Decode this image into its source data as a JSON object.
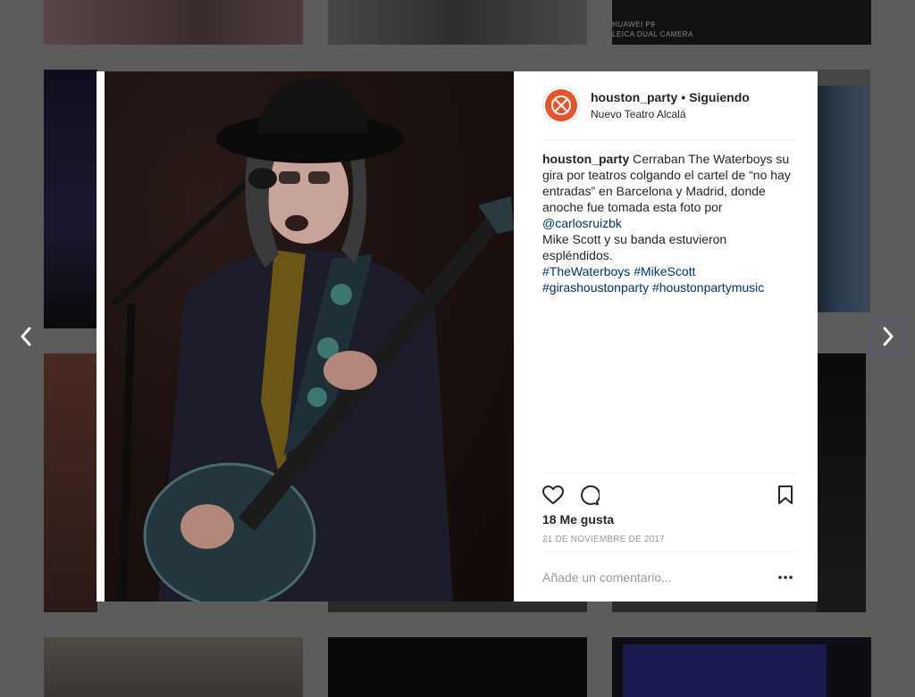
{
  "background": {
    "camera_watermark_line1": "HUAWEI P9",
    "camera_watermark_line2": "LEICA DUAL CAMERA"
  },
  "post": {
    "username": "houston_party",
    "separator": "•",
    "follow_status": "Siguiendo",
    "location": "Nuevo Teatro Alcalá",
    "avatar_icon": "houston-party-logo-icon",
    "caption": {
      "username": "houston_party",
      "line1": " Cerraban The Waterboys su gira por teatros colgando el cartel de “no hay entradas” en Barcelona y Madrid, donde anoche fue tomada esta foto por ",
      "mention": "@carlosruizbk",
      "line2": "Mike Scott y su banda estuvieron espléndidos.",
      "hashtags": [
        "#TheWaterboys",
        "#MikeScott",
        "#girashoustonparty",
        "#houstonpartymusic"
      ]
    },
    "likes_text": "18 Me gusta",
    "date": "21 DE NOVIEMBRE DE 2017",
    "comment_placeholder": "Añade un comentario...",
    "icons": [
      "heart-icon",
      "comment-icon",
      "bookmark-icon",
      "more-options-icon"
    ]
  },
  "nav": {
    "prev_icon": "chevron-left-icon",
    "next_icon": "chevron-right-icon"
  },
  "colors": {
    "brand": "#e8542a",
    "link": "#003569",
    "overlay": "#5c5c5c"
  }
}
